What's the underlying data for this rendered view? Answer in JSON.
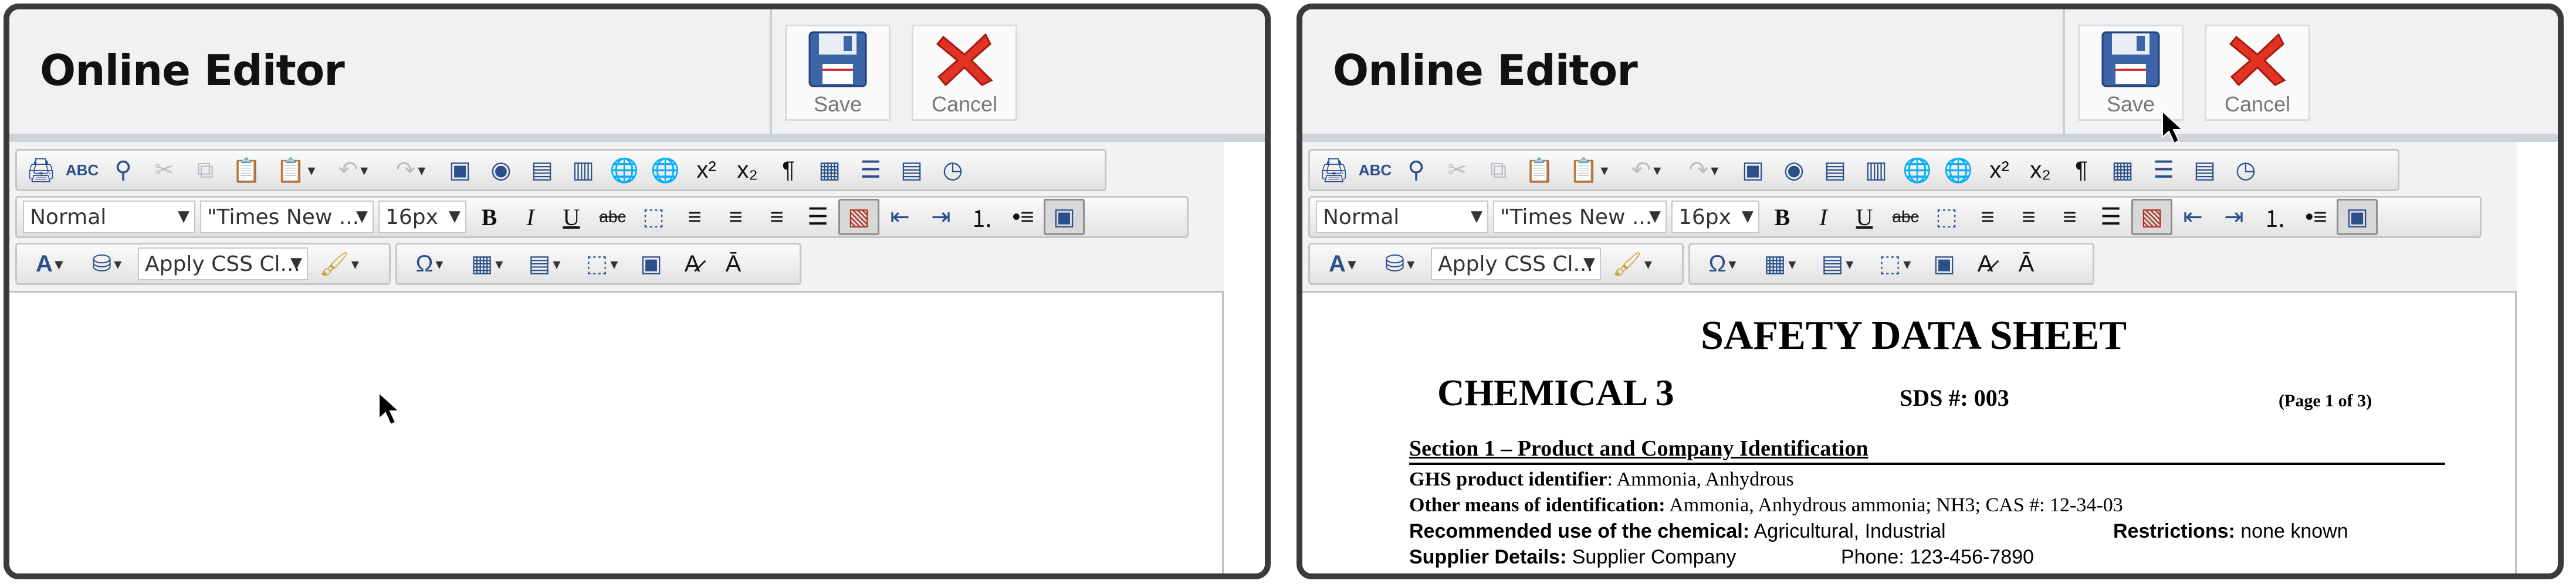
{
  "left": {
    "title": "Online Editor",
    "save_label": "Save",
    "cancel_label": "Cancel",
    "format_select": "Normal",
    "font_select": "\"Times New ...",
    "size_select": "16px",
    "css_class_select": "Apply CSS Cl..."
  },
  "right": {
    "title": "Online Editor",
    "save_label": "Save",
    "cancel_label": "Cancel",
    "format_select": "Normal",
    "font_select": "\"Times New ...",
    "size_select": "16px",
    "css_class_select": "Apply CSS Cl...",
    "document": {
      "heading": "SAFETY DATA SHEET",
      "chemical": "CHEMICAL 3",
      "sds_number": "SDS #: 003",
      "page_info": "(Page 1 of 3)",
      "section1": "Section 1 – Product and Company Identification",
      "ghs_label": "GHS product identifier",
      "ghs_value": ":  Ammonia, Anhydrous",
      "other_label": "Other means of identification:",
      "other_value": "  Ammonia, Anhydrous ammonia; NH3; CAS #: 12-34-03",
      "use_label": "Recommended use of the chemical:",
      "use_value": "  Agricultural, Industrial",
      "restrictions_label": "Restrictions:",
      "restrictions_value": "  none known",
      "supplier_label": "Supplier Details:",
      "supplier_value": "  Supplier Company",
      "phone_label": "Phone:",
      "phone_value": "  123-456-7890"
    }
  },
  "icons": {
    "toolbar_row1": [
      "print-icon",
      "spellcheck-icon",
      "find-icon",
      "cut-icon",
      "copy-icon",
      "paste-icon",
      "paste-options-icon",
      "undo-icon",
      "redo-icon",
      "image-icon",
      "media-icon",
      "flash-icon",
      "document-properties-icon",
      "link-icon",
      "unlink-icon",
      "superscript-icon",
      "subscript-icon",
      "paragraph-icon",
      "template-icon",
      "horizontal-rule-icon",
      "form-icon",
      "time-icon"
    ],
    "toolbar_row2": [
      "bold-icon",
      "italic-icon",
      "underline-icon",
      "strikethrough-icon",
      "select-all-icon",
      "align-left-icon",
      "align-center-icon",
      "align-right-icon",
      "justify-icon",
      "background-icon",
      "outdent-icon",
      "indent-icon",
      "numbered-list-icon",
      "bulleted-list-icon",
      "preview-icon"
    ],
    "toolbar_row3": [
      "font-color-icon",
      "highlight-icon",
      "format-stripper-icon",
      "special-character-icon",
      "table-icon",
      "form-element-icon",
      "snippet-icon",
      "image-manager-icon",
      "spell-icon",
      "style-icon"
    ]
  },
  "colors": {
    "save_blue": "#3e64a8",
    "cancel_red": "#e13224",
    "toolbar_icon": "#2a4f8a"
  }
}
